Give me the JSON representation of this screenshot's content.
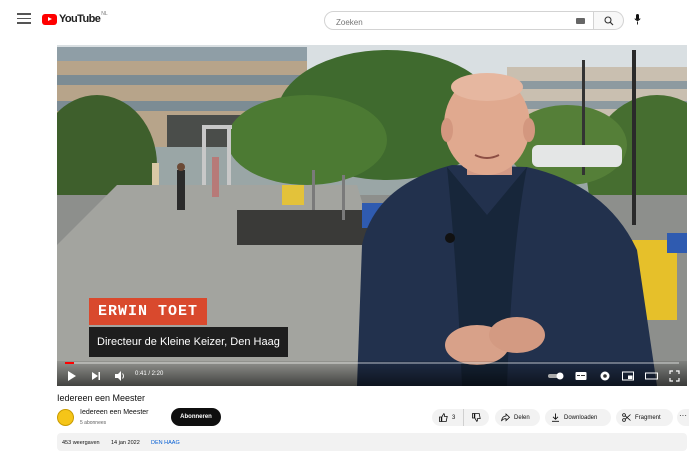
{
  "header": {
    "logo_text": "YouTube",
    "country_code": "NL",
    "search_placeholder": "Zoeken"
  },
  "video": {
    "overlay_name": "ERWIN TOET",
    "overlay_role": "Directeur de Kleine Keizer, Den Haag",
    "time_display": "0:41 / 2:20",
    "progress_fraction": 0.014
  },
  "info": {
    "title": "Iedereen een Meester",
    "channel_name": "Iedereen een Meester",
    "subscribers": "5 abonnees",
    "subscribe_label": "Abonneren",
    "like_count": "3",
    "share_label": "Delen",
    "download_label": "Downloaden",
    "clip_label": "Fragment",
    "more_label": "···",
    "views": "453 weergaven",
    "date": "14 jan 2022",
    "tag": "DEN HAAG"
  },
  "colors": {
    "brand_red": "#ff0000",
    "name_banner": "#d9492d",
    "link_blue": "#065fd4"
  },
  "icons": [
    "menu-icon",
    "youtube-logo-icon",
    "keyboard-icon",
    "search-icon",
    "mic-icon",
    "play-icon",
    "next-icon",
    "volume-icon",
    "autoplay-toggle-icon",
    "subtitles-icon",
    "settings-icon",
    "miniplayer-icon",
    "theater-icon",
    "fullscreen-icon",
    "thumbs-up-icon",
    "thumbs-down-icon",
    "share-icon",
    "download-icon",
    "scissors-icon"
  ]
}
